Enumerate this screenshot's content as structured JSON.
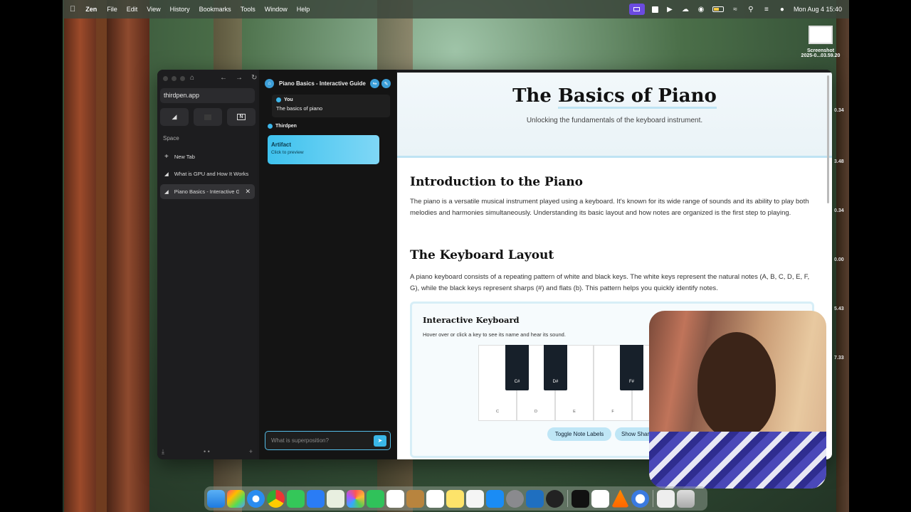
{
  "menubar": {
    "app_name": "Zen",
    "menus": [
      "File",
      "Edit",
      "View",
      "History",
      "Bookmarks",
      "Tools",
      "Window",
      "Help"
    ],
    "clock": "Mon Aug 4  15:40"
  },
  "desktop": {
    "file_icon_label_1": "Screenshot",
    "file_icon_label_2": "2025-0...03.59.20",
    "side_numbers": [
      "0.34",
      "3.48",
      "0.34",
      "0.00",
      "5.43",
      "7.33"
    ]
  },
  "sidebar": {
    "url": "thirdpen.app",
    "space_label": "Space",
    "new_tab_label": "New Tab",
    "tabs": [
      {
        "label": "What is GPU and How It Works"
      },
      {
        "label": "Piano Basics - Interactive Guide"
      }
    ]
  },
  "chat": {
    "title": "Piano Basics - Interactive Guide",
    "user_name": "You",
    "user_message": "The basics of piano",
    "bot_name": "Thirdpen",
    "artifact_title": "Artifact",
    "artifact_subtitle": "Click to preview",
    "input_placeholder": "What is superposition?"
  },
  "content": {
    "title_plain": "The ",
    "title_highlight": "Basics of Piano",
    "subtitle": "Unlocking the fundamentals of the keyboard instrument.",
    "intro_heading": "Introduction to the Piano",
    "intro_text": "The piano is a versatile musical instrument played using a keyboard. It's known for its wide range of sounds and its ability to play both melodies and harmonies simultaneously. Understanding its basic layout and how notes are organized is the first step to playing.",
    "layout_heading": "The Keyboard Layout",
    "layout_text": "A piano keyboard consists of a repeating pattern of white and black keys. The white keys represent the natural notes (A, B, C, D, E, F, G), while the black keys represent sharps (#) and flats (b). This pattern helps you quickly identify notes.",
    "keyboard": {
      "heading": "Interactive Keyboard",
      "hint": "Hover over or click a key to see its name and hear its sound.",
      "white_keys": [
        "C",
        "D",
        "E",
        "F",
        "G"
      ],
      "black_keys": [
        "C#",
        "D#",
        "F#"
      ],
      "toggle_button": "Toggle Note Labels",
      "show_button": "Show Shar"
    }
  },
  "colors": {
    "accent": "#3db6ea",
    "highlight": "#bfe3f3",
    "window_bg": "#1c1c1e"
  }
}
